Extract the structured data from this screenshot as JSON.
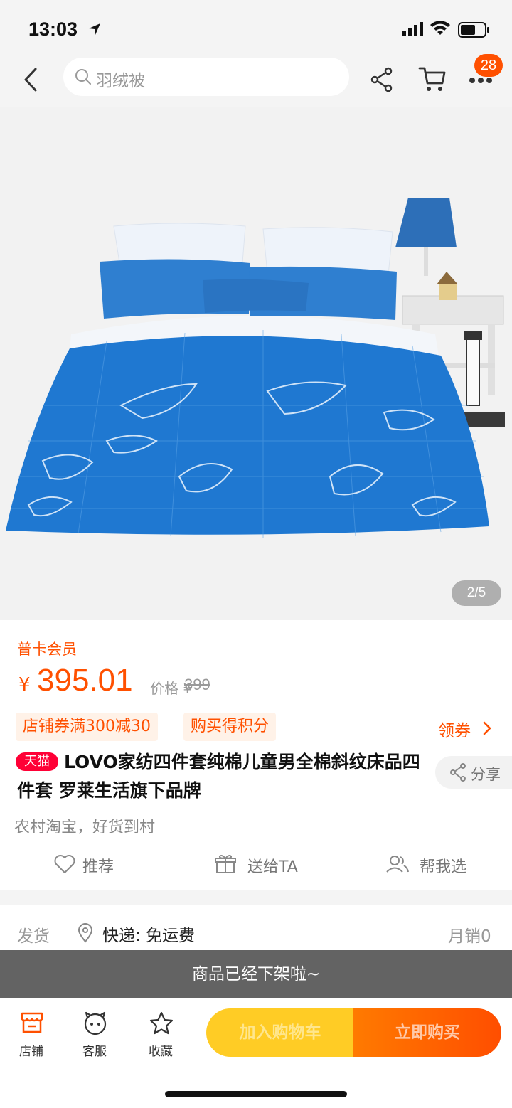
{
  "status_bar": {
    "time": "13:03"
  },
  "nav": {
    "search_placeholder": "羽绒被",
    "cart_badge": "28"
  },
  "gallery": {
    "counter": "2/5"
  },
  "product": {
    "member_label": "普卡会员",
    "currency": "¥",
    "price": "395.01",
    "orig_price_label": "价格 ¥",
    "orig_price": "399",
    "tags": [
      "店铺券满300减30",
      "购买得积分"
    ],
    "coupon_link": "领券",
    "tmall_badge": "天猫",
    "title": "LOVO家纺四件套纯棉儿童男全棉斜纹床品四件套 罗莱生活旗下品牌",
    "share_label": "分享",
    "slogan": "农村淘宝，好货到村",
    "actions": [
      "推荐",
      "送给TA",
      "帮我选"
    ]
  },
  "shipping": {
    "label": "发货",
    "method": "快递: 免运费",
    "sales": "月销0"
  },
  "notice": "商品已经下架啦~",
  "bottom_bar": {
    "tabs": [
      "店铺",
      "客服",
      "收藏"
    ],
    "add_to_cart": "加入购物车",
    "buy_now": "立即购买"
  },
  "colors": {
    "accent": "#ff5000",
    "tmall": "#ff0036",
    "cart_btn": "#ffc400"
  }
}
